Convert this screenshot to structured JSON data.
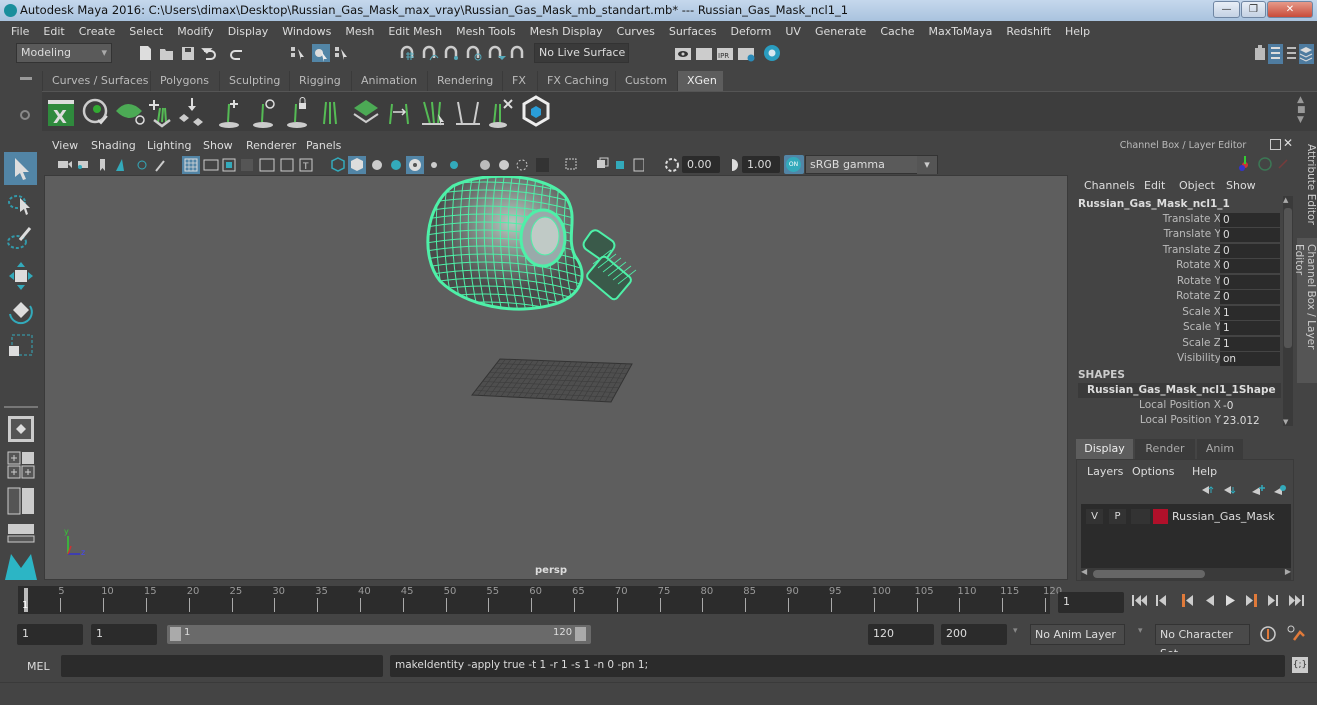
{
  "window": {
    "title": "Autodesk Maya 2016: C:\\Users\\dimax\\Desktop\\Russian_Gas_Mask_max_vray\\Russian_Gas_Mask_mb_standart.mb*   ---   Russian_Gas_Mask_ncl1_1",
    "minimize": "—",
    "restore": "❐",
    "close": "✕"
  },
  "menubar": [
    "File",
    "Edit",
    "Create",
    "Select",
    "Modify",
    "Display",
    "Windows",
    "Mesh",
    "Edit Mesh",
    "Mesh Tools",
    "Mesh Display",
    "Curves",
    "Surfaces",
    "Deform",
    "UV",
    "Generate",
    "Cache",
    "MaxToMaya",
    "Redshift",
    "Help"
  ],
  "statusline": {
    "menuset": "Modeling",
    "live_surface": "No Live Surface"
  },
  "shelf": {
    "tabs": [
      "Curves / Surfaces",
      "Polygons",
      "Sculpting",
      "Rigging",
      "Animation",
      "Rendering",
      "FX",
      "FX Caching",
      "Custom",
      "XGen"
    ],
    "active_tab": "XGen",
    "icons": [
      "xgen-editor-icon",
      "xgen-preview-icon",
      "xgen-clear-preview-icon",
      "add-guide-icon",
      "place-guide-icon",
      "add-guide-tool-icon",
      "sculpt-guide-icon",
      "lock-guide-icon",
      "guides-icon",
      "region-map-icon",
      "flip-guide-icon",
      "select-guide-icon",
      "guide-outline-icon",
      "delete-guide-icon",
      "render-icon"
    ]
  },
  "viewport": {
    "menu": [
      "View",
      "Shading",
      "Lighting",
      "Show",
      "Renderer",
      "Panels"
    ],
    "exposure": "0.00",
    "gamma": "1.00",
    "color_mgmt": "ON",
    "colorspace": "sRGB gamma",
    "camera_label": "persp",
    "axis": {
      "y": "y",
      "z": "z"
    },
    "wire_color": "#4ef0a8"
  },
  "channelbox": {
    "header": "Channel Box / Layer Editor",
    "menu": [
      "Channels",
      "Edit",
      "Object",
      "Show"
    ],
    "object": "Russian_Gas_Mask_ncl1_1",
    "attrs": [
      {
        "label": "Translate X",
        "value": "0"
      },
      {
        "label": "Translate Y",
        "value": "0"
      },
      {
        "label": "Translate Z",
        "value": "0"
      },
      {
        "label": "Rotate X",
        "value": "0"
      },
      {
        "label": "Rotate Y",
        "value": "0"
      },
      {
        "label": "Rotate Z",
        "value": "0"
      },
      {
        "label": "Scale X",
        "value": "1"
      },
      {
        "label": "Scale Y",
        "value": "1"
      },
      {
        "label": "Scale Z",
        "value": "1"
      },
      {
        "label": "Visibility",
        "value": "on"
      }
    ],
    "shapes_header": "SHAPES",
    "shape_name": "Russian_Gas_Mask_ncl1_1Shape",
    "shape_attrs": [
      {
        "label": "Local Position X",
        "value": "-0"
      },
      {
        "label": "Local Position Y",
        "value": "23.012"
      }
    ]
  },
  "side_tabs": {
    "attribute_editor": "Attribute Editor",
    "channel_box": "Channel Box / Layer Editor"
  },
  "layer_editor": {
    "tabs": [
      "Display",
      "Render",
      "Anim"
    ],
    "active_tab": "Display",
    "menu": [
      "Layers",
      "Options",
      "Help"
    ],
    "layers": [
      {
        "v": "V",
        "p": "P",
        "name": "Russian_Gas_Mask",
        "color": "#b0102a"
      }
    ]
  },
  "timeline": {
    "ticks": [
      "5",
      "10",
      "15",
      "20",
      "25",
      "30",
      "35",
      "40",
      "45",
      "50",
      "55",
      "60",
      "65",
      "70",
      "75",
      "80",
      "85",
      "90",
      "95",
      "100",
      "105",
      "110",
      "115",
      "120"
    ],
    "current_frame_marker": "1",
    "current_frame": "1"
  },
  "range": {
    "start": "1",
    "anim_start": "1",
    "slider_start": "1",
    "slider_end": "120",
    "end": "120",
    "anim_end": "200",
    "anim_layer": "No Anim Layer",
    "character_set": "No Character Set"
  },
  "commandline": {
    "lang": "MEL",
    "input": "",
    "result": "makeIdentity -apply true -t 1 -r 1 -s 1 -n 0 -pn 1;"
  }
}
